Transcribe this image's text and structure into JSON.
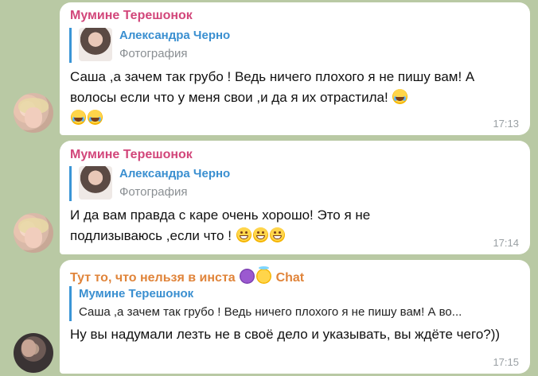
{
  "colors": {
    "background": "#b9c9a4",
    "sender_pink": "#d2467a",
    "sender_orange": "#e0843a",
    "reply_blue": "#3a8fd0"
  },
  "messages": [
    {
      "sender": "Мумине Терешонок",
      "reply": {
        "name": "Александра Черно",
        "text": "Фотография"
      },
      "text": "Саша ,а зачем так грубо ! Ведь ничего плохого я не пишу вам!  А волосы если что у меня свои ,и да я их отрастила!",
      "emoji": "😂😂😂",
      "time": "17:13"
    },
    {
      "sender": "Мумине Терешонок",
      "reply": {
        "name": "Александра Черно",
        "text": "Фотография"
      },
      "text": "И да вам правда  с каре очень хорошо! Это я не подлизываюсь ,если что !",
      "emoji": "😁😁😁",
      "time": "17:14"
    },
    {
      "sender": "Тут то, что нельзя в инста",
      "sender_suffix": "Chat",
      "reply": {
        "name": "Мумине Терешонок",
        "text": "Саша ,а зачем так грубо ! Ведь ничего плохого я не пишу вам! А во..."
      },
      "text": "Ну вы надумали лезть не в своё дело и указывать, вы ждёте чего?))",
      "time": "17:15"
    }
  ]
}
